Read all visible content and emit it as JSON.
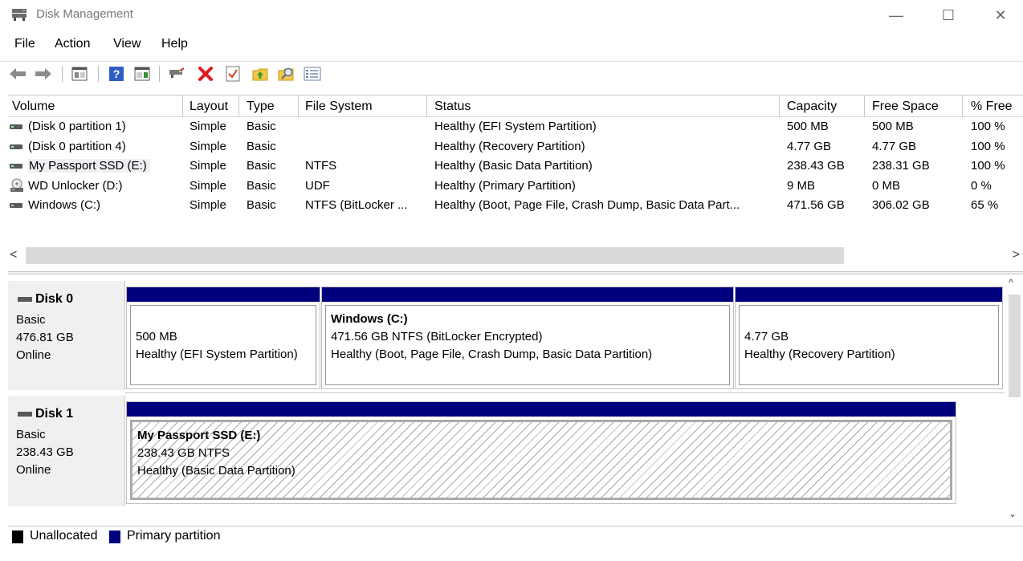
{
  "window": {
    "title": "Disk Management",
    "minimize_glyph": "—",
    "maximize_glyph": "☐",
    "close_glyph": "✕"
  },
  "menu": [
    "File",
    "Action",
    "View",
    "Help"
  ],
  "toolbar": {
    "icons": [
      "back-icon",
      "forward-icon",
      "show-hide-console-tree-icon",
      "help-icon",
      "show-hide-action-pane-icon",
      "connect-icon",
      "delete-icon",
      "properties-icon",
      "up-icon",
      "search-icon",
      "details-icon"
    ]
  },
  "volume_list": {
    "columns": [
      "Volume",
      "Layout",
      "Type",
      "File System",
      "Status",
      "Capacity",
      "Free Space",
      "% Free"
    ],
    "rows": [
      {
        "volume": "(Disk 0 partition 1)",
        "layout": "Simple",
        "type": "Basic",
        "fs": "",
        "status": "Healthy (EFI System Partition)",
        "capacity": "500 MB",
        "free": "500 MB",
        "pct": "100 %",
        "icon": "drive-icon"
      },
      {
        "volume": "(Disk 0 partition 4)",
        "layout": "Simple",
        "type": "Basic",
        "fs": "",
        "status": "Healthy (Recovery Partition)",
        "capacity": "4.77 GB",
        "free": "4.77 GB",
        "pct": "100 %",
        "icon": "drive-icon"
      },
      {
        "volume": "My Passport SSD (E:)",
        "layout": "Simple",
        "type": "Basic",
        "fs": "NTFS",
        "status": "Healthy (Basic Data Partition)",
        "capacity": "238.43 GB",
        "free": "238.31 GB",
        "pct": "100 %",
        "icon": "drive-icon"
      },
      {
        "volume": "WD Unlocker (D:)",
        "layout": "Simple",
        "type": "Basic",
        "fs": "UDF",
        "status": "Healthy (Primary Partition)",
        "capacity": "9 MB",
        "free": "0 MB",
        "pct": "0 %",
        "icon": "cd-drive-icon"
      },
      {
        "volume": "Windows (C:)",
        "layout": "Simple",
        "type": "Basic",
        "fs": "NTFS (BitLocker ...",
        "status": "Healthy (Boot, Page File, Crash Dump, Basic Data Part...",
        "capacity": "471.56 GB",
        "free": "306.02 GB",
        "pct": "65 %",
        "icon": "drive-icon"
      }
    ]
  },
  "scroll": {
    "left": "<",
    "right": ">",
    "up": "^",
    "down": "⌄"
  },
  "disks": [
    {
      "name": "Disk 0",
      "type": "Basic",
      "size": "476.81 GB",
      "state": "Online",
      "partitions": [
        {
          "title": "",
          "line1": "500 MB",
          "line2": "Healthy (EFI System Partition)"
        },
        {
          "title": "Windows  (C:)",
          "line1": "471.56 GB NTFS (BitLocker Encrypted)",
          "line2": "Healthy (Boot, Page File, Crash Dump, Basic Data Partition)"
        },
        {
          "title": "",
          "line1": "4.77 GB",
          "line2": "Healthy (Recovery Partition)"
        }
      ]
    },
    {
      "name": "Disk 1",
      "type": "Basic",
      "size": "238.43 GB",
      "state": "Online",
      "partitions": [
        {
          "title": "My Passport SSD  (E:)",
          "line1": "238.43 GB NTFS",
          "line2": "Healthy (Basic Data Partition)"
        }
      ]
    }
  ],
  "legend": [
    {
      "label": "Unallocated",
      "color": "#000000"
    },
    {
      "label": "Primary partition",
      "color": "#00007f"
    }
  ]
}
